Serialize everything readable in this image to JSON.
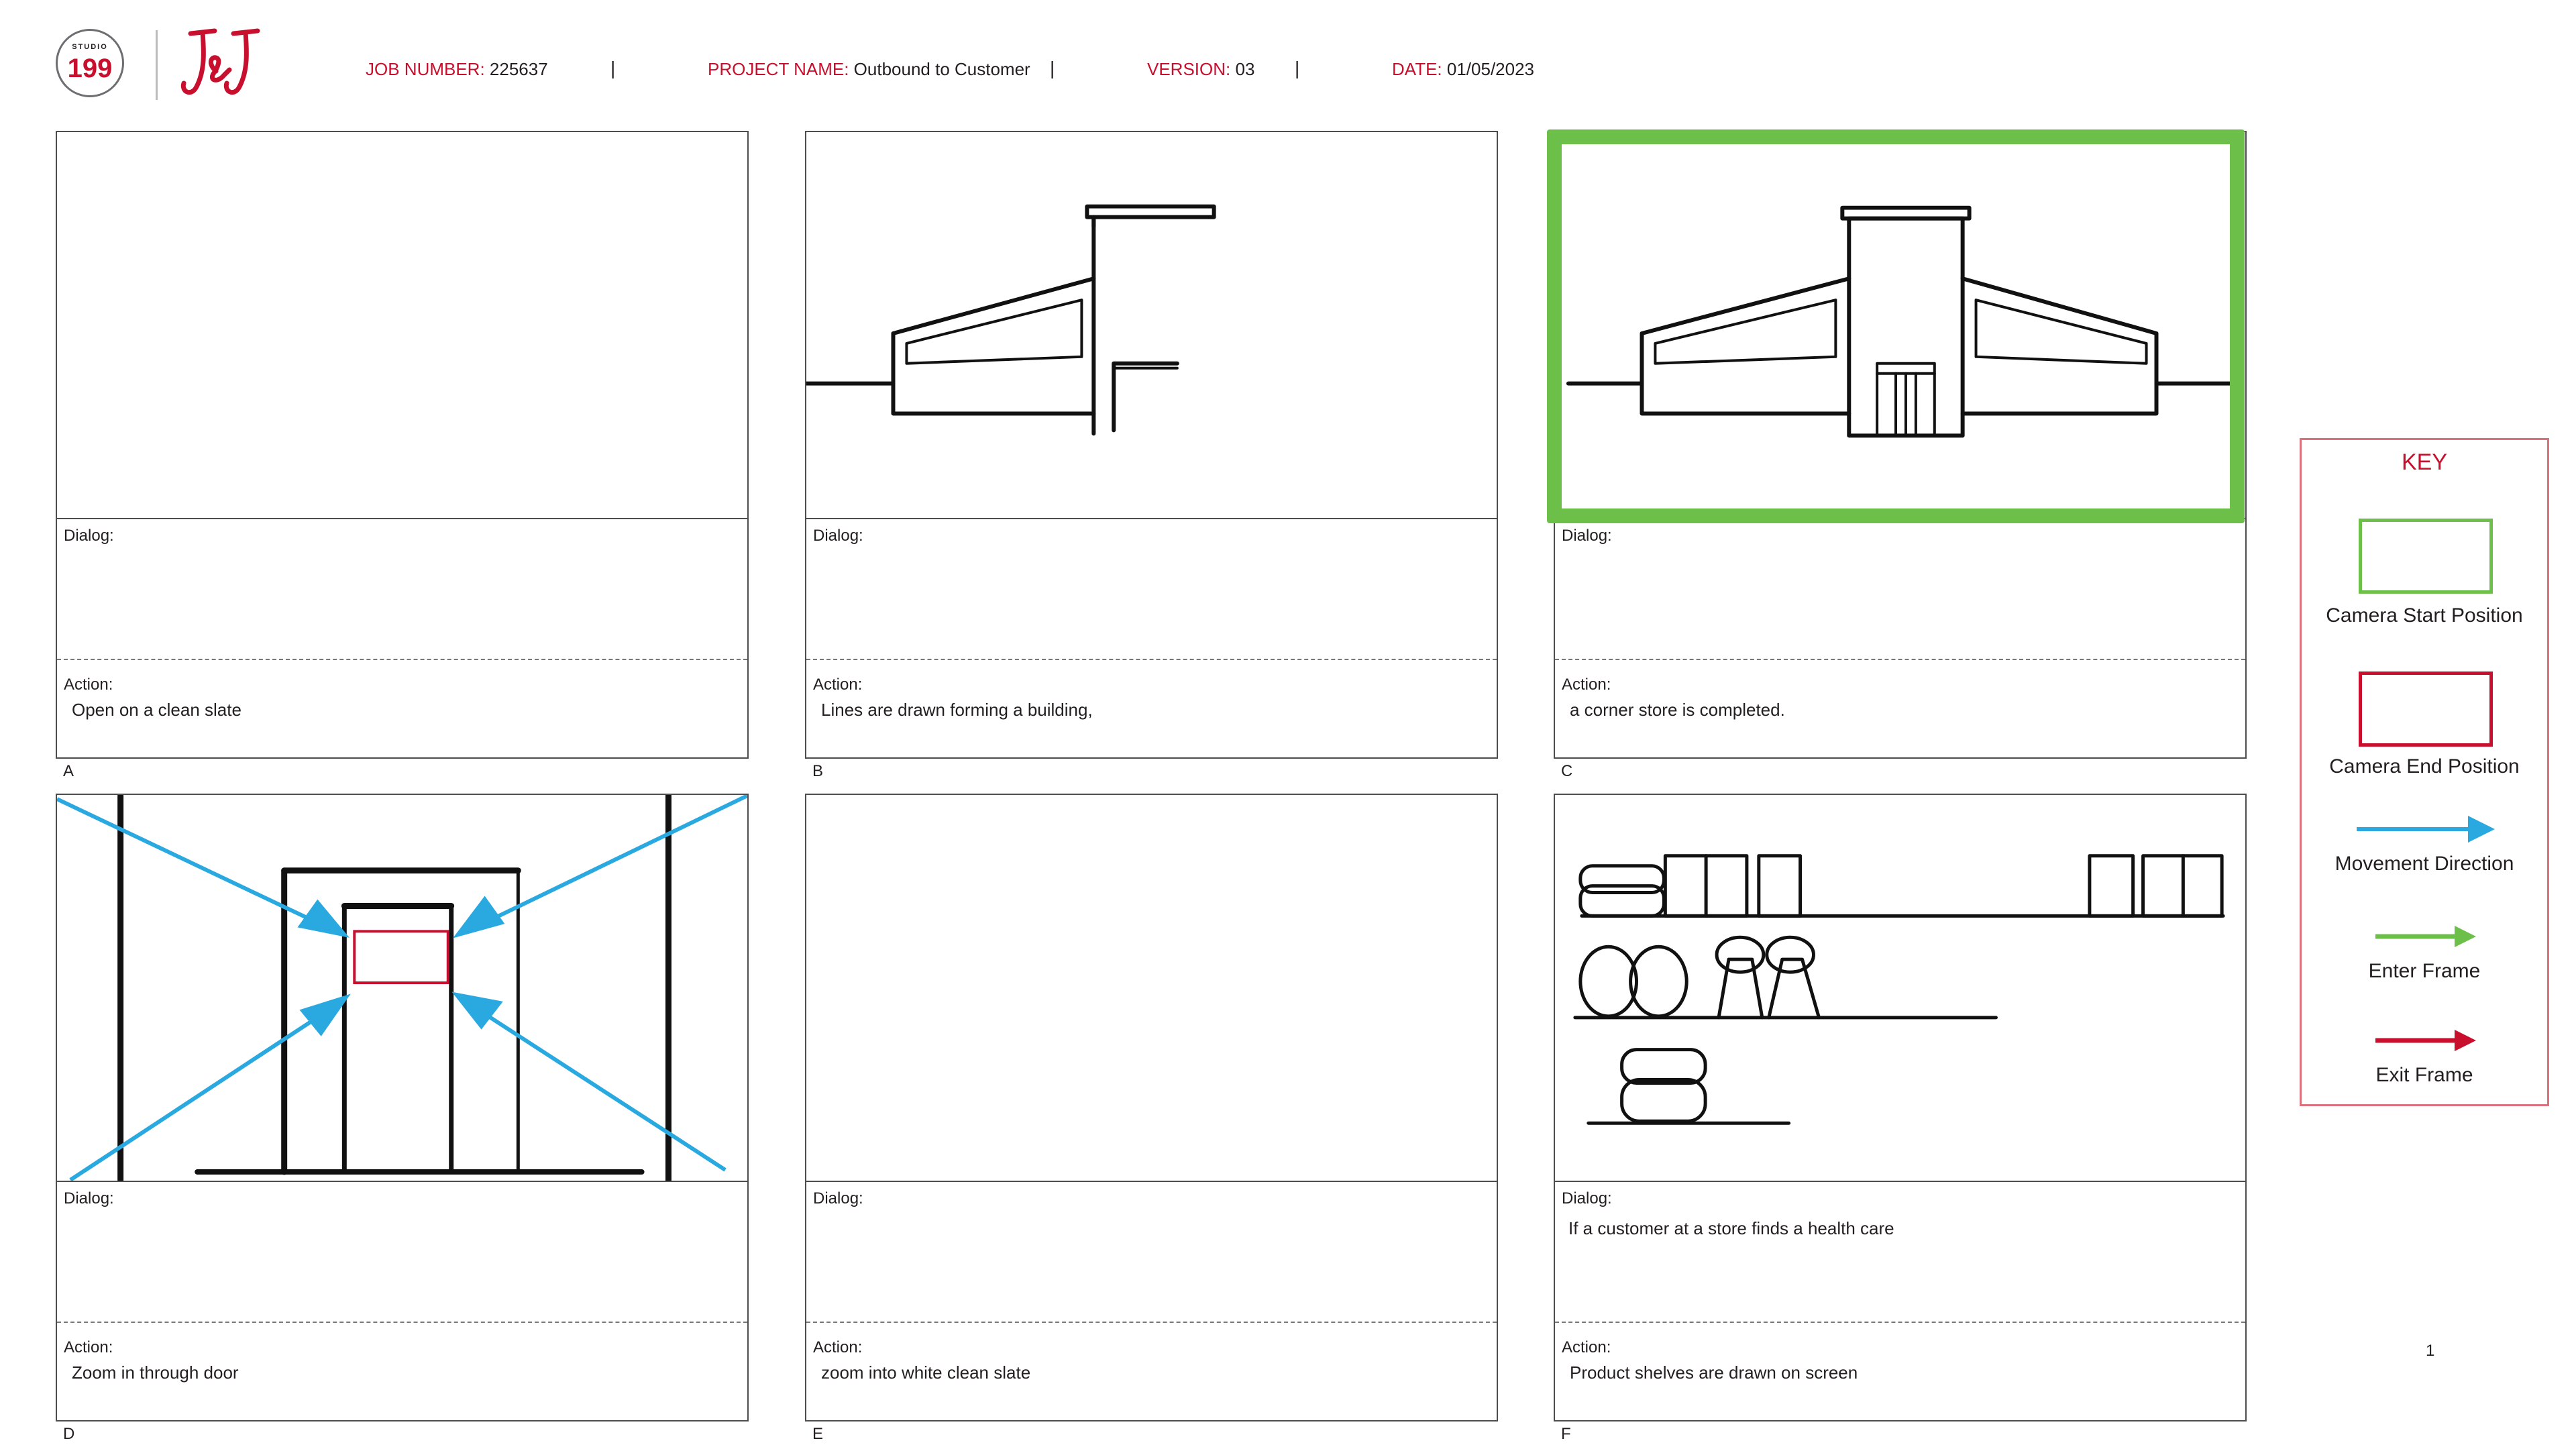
{
  "header": {
    "logo_studio_text": "STUDIO",
    "logo_number": "199",
    "jj_logo_text": "J&J",
    "job_number_label": "JOB NUMBER:",
    "job_number_value": "225637",
    "project_name_label": "PROJECT NAME:",
    "project_name_value": "Outbound to Customer",
    "version_label": "VERSION:",
    "version_value": "03",
    "date_label": "DATE:",
    "date_value": "01/05/2023",
    "separator": "|"
  },
  "panels": [
    {
      "letter": "A",
      "dialog_label": "Dialog:",
      "dialog_text": "",
      "action_label": "Action:",
      "action_text": "Open on a clean slate"
    },
    {
      "letter": "B",
      "dialog_label": "Dialog:",
      "dialog_text": "",
      "action_label": "Action:",
      "action_text": "Lines are drawn forming a building,"
    },
    {
      "letter": "C",
      "dialog_label": "Dialog:",
      "dialog_text": "",
      "action_label": "Action:",
      "action_text": "a corner store is completed."
    },
    {
      "letter": "D",
      "dialog_label": "Dialog:",
      "dialog_text": "",
      "action_label": "Action:",
      "action_text": "Zoom in through door"
    },
    {
      "letter": "E",
      "dialog_label": "Dialog:",
      "dialog_text": "",
      "action_label": "Action:",
      "action_text": "zoom into white clean slate"
    },
    {
      "letter": "F",
      "dialog_label": "Dialog:",
      "dialog_text": "If a customer at a store finds a health care",
      "action_label": "Action:",
      "action_text": "Product shelves are drawn on screen"
    }
  ],
  "key": {
    "title": "KEY",
    "camera_start": "Camera Start Position",
    "camera_end": "Camera End Position",
    "movement": "Movement Direction",
    "enter": "Enter Frame",
    "exit": "Exit Frame"
  },
  "colors": {
    "brand_red": "#c8102e",
    "camera_start_green": "#6cc04a",
    "camera_end_red": "#c8102e",
    "movement_blue": "#29a9e0",
    "enter_green": "#6cc04a",
    "exit_red": "#c8102e"
  },
  "page_number": "1"
}
